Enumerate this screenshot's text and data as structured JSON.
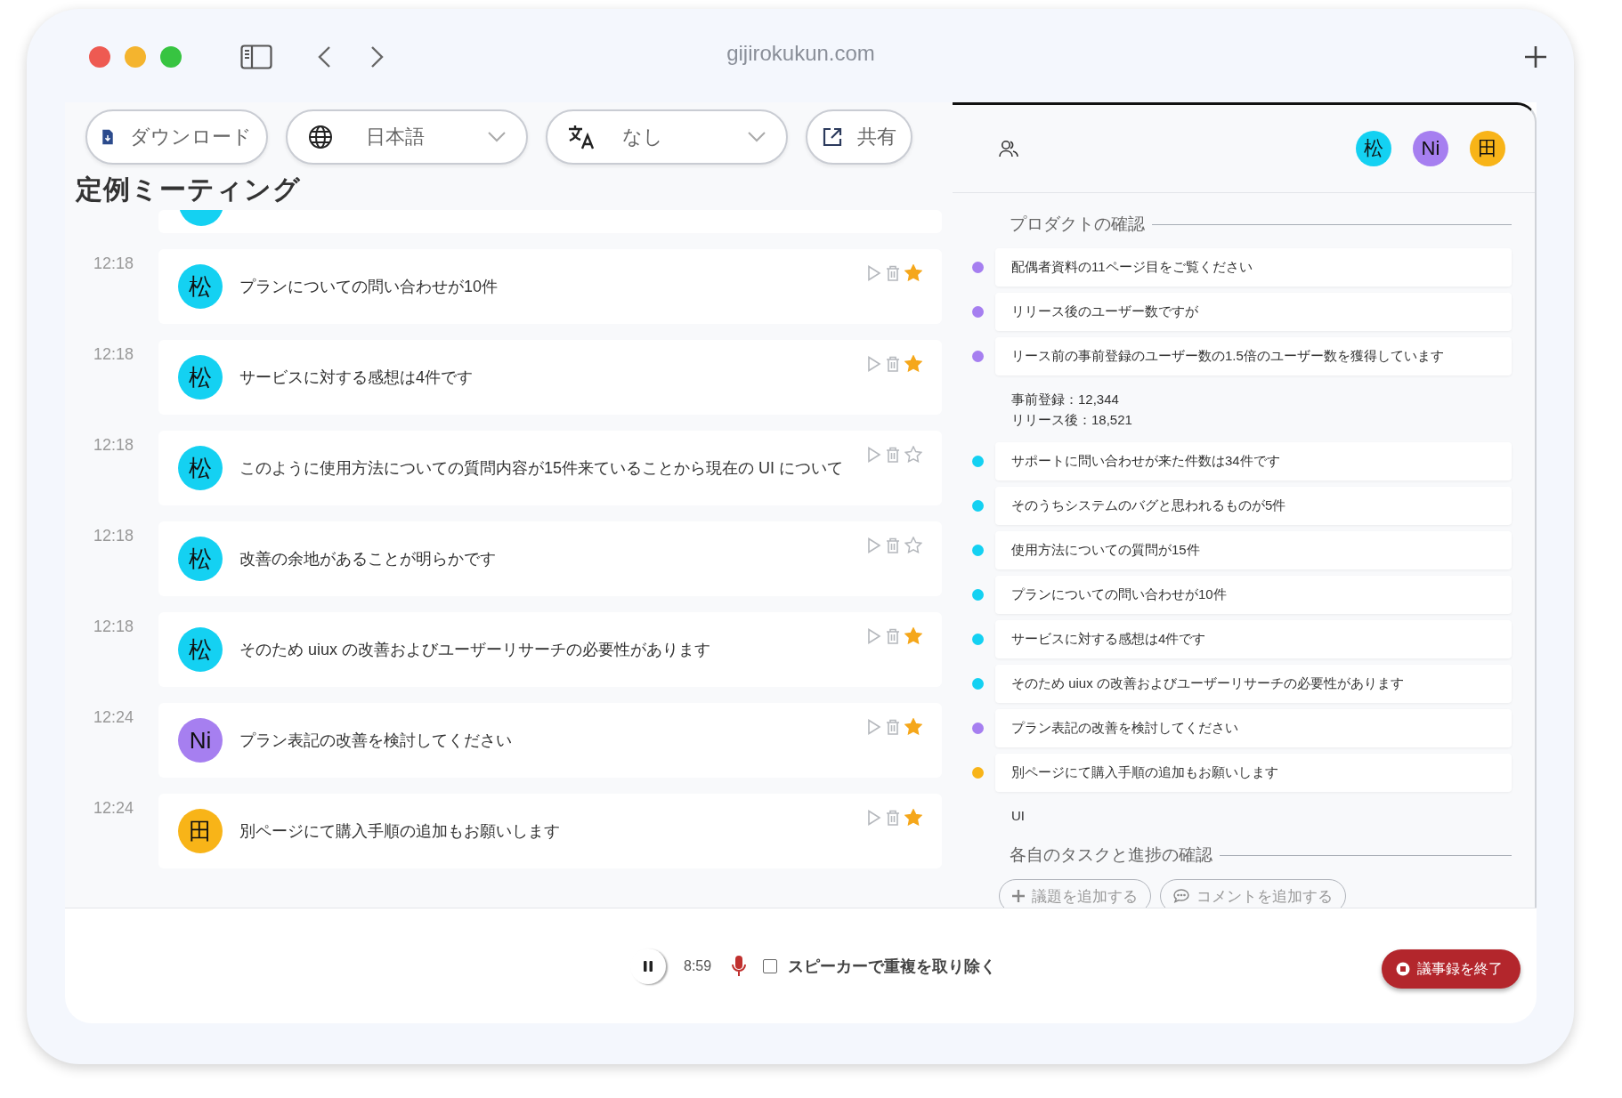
{
  "browser": {
    "url": "gijirokukun.com"
  },
  "toolbar": {
    "download": "ダウンロード",
    "language": "日本語",
    "translation": "なし",
    "share": "共有"
  },
  "meeting_title": "定例ミーティング",
  "messages": [
    {
      "time": "12:18",
      "speaker": "松",
      "color": "#14d1f2",
      "text": "プランについての問い合わせが10件",
      "starred": true
    },
    {
      "time": "12:18",
      "speaker": "松",
      "color": "#14d1f2",
      "text": "サービスに対する感想は4件です",
      "starred": true
    },
    {
      "time": "12:18",
      "speaker": "松",
      "color": "#14d1f2",
      "text": "このように使用方法についての質問内容が15件来ていることから現在の UI について",
      "starred": false
    },
    {
      "time": "12:18",
      "speaker": "松",
      "color": "#14d1f2",
      "text": "改善の余地があることが明らかです",
      "starred": false
    },
    {
      "time": "12:18",
      "speaker": "松",
      "color": "#14d1f2",
      "text": "そのため uiux の改善およびユーザーリサーチの必要性があります",
      "starred": true
    },
    {
      "time": "12:24",
      "speaker": "Ni",
      "color": "#a67ff0",
      "text": "プラン表記の改善を検討してください",
      "starred": true
    },
    {
      "time": "12:24",
      "speaker": "田",
      "color": "#f8b418",
      "text": "別ページにて購入手順の追加もお願いします",
      "starred": true
    }
  ],
  "participants": [
    {
      "label": "松",
      "color": "#14d1f2"
    },
    {
      "label": "Ni",
      "color": "#a67ff0"
    },
    {
      "label": "田",
      "color": "#f8b418"
    }
  ],
  "agenda": [
    {
      "title": "プロダクトの確認",
      "items": [
        {
          "kind": "point",
          "text": "配偶者資料の11ページ目をご覧ください",
          "color": "#a67ff0"
        },
        {
          "kind": "point",
          "text": "リリース後のユーザー数ですが",
          "color": "#a67ff0"
        },
        {
          "kind": "point",
          "text": "リース前の事前登録のユーザー数の1.5倍のユーザー数を獲得しています",
          "color": "#a67ff0"
        },
        {
          "kind": "note",
          "lines": [
            "事前登録：12,344",
            "リリース後：18,521"
          ]
        },
        {
          "kind": "point",
          "text": "サポートに問い合わせが来た件数は34件です",
          "color": "#14d1f2"
        },
        {
          "kind": "point",
          "text": "そのうちシステムのバグと思われるものが5件",
          "color": "#14d1f2"
        },
        {
          "kind": "point",
          "text": "使用方法についての質問が15件",
          "color": "#14d1f2"
        },
        {
          "kind": "point",
          "text": "プランについての問い合わせが10件",
          "color": "#14d1f2"
        },
        {
          "kind": "point",
          "text": "サービスに対する感想は4件です",
          "color": "#14d1f2"
        },
        {
          "kind": "point",
          "text": "そのため uiux の改善およびユーザーリサーチの必要性があります",
          "color": "#14d1f2"
        },
        {
          "kind": "point",
          "text": "プラン表記の改善を検討してください",
          "color": "#a67ff0"
        },
        {
          "kind": "point",
          "text": "別ページにて購入手順の追加もお願いします",
          "color": "#f8b418"
        },
        {
          "kind": "note",
          "lines": [
            "UI"
          ]
        }
      ]
    },
    {
      "title": "各自のタスクと進捗の確認"
    }
  ],
  "agenda_actions": [
    "議題を追加する",
    "コメントを追加する"
  ],
  "recorder": {
    "elapsed": "8:59",
    "dedupe_label": "スピーカーで重複を取り除く",
    "dedupe_checked": false,
    "end_button": "議事録を終了"
  }
}
